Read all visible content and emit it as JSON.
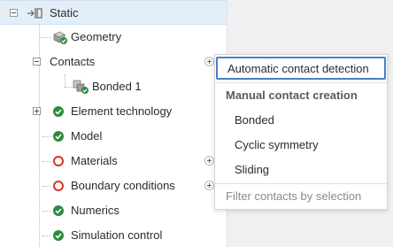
{
  "tree": {
    "items": [
      {
        "label": "Static",
        "icon": "static-analysis-icon",
        "expander": "minus",
        "selected": true
      },
      {
        "label": "Geometry",
        "icon": "geometry-icon",
        "status": "ok"
      },
      {
        "label": "Contacts",
        "expander": "minus"
      },
      {
        "label": "Bonded 1",
        "icon": "bonded-contact-icon",
        "status": "ok"
      },
      {
        "label": "Element technology",
        "expander": "plus",
        "status": "ok"
      },
      {
        "label": "Model",
        "status": "ok"
      },
      {
        "label": "Materials",
        "status": "error"
      },
      {
        "label": "Boundary conditions",
        "status": "error"
      },
      {
        "label": "Numerics",
        "status": "ok"
      },
      {
        "label": "Simulation control",
        "status": "ok"
      }
    ]
  },
  "contact_menu": {
    "focused_item": "Automatic contact detection",
    "section_header": "Manual contact creation",
    "items": [
      "Bonded",
      "Cyclic symmetry",
      "Sliding"
    ],
    "filter_item": "Filter contacts by selection"
  },
  "colors": {
    "ok": "#2e8b3e",
    "error": "#d3372c",
    "focus_border": "#4a7fc8",
    "selected_row": "#e4eef7"
  }
}
